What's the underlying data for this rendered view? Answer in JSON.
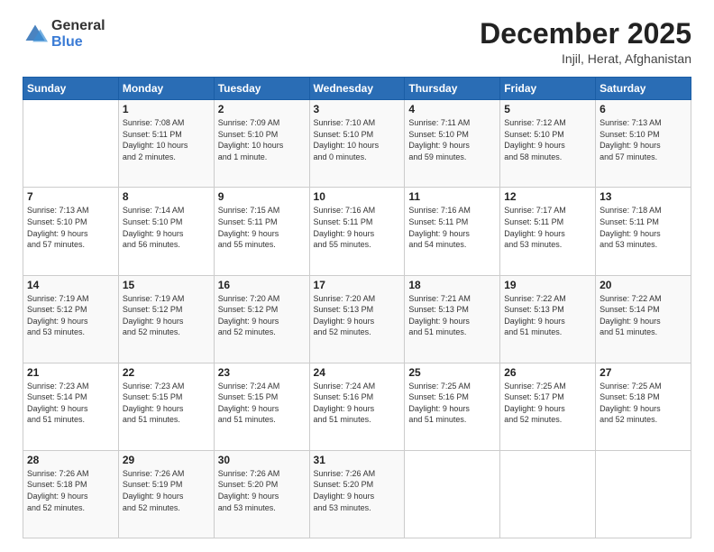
{
  "logo": {
    "general": "General",
    "blue": "Blue"
  },
  "header": {
    "month": "December 2025",
    "location": "Injil, Herat, Afghanistan"
  },
  "weekdays": [
    "Sunday",
    "Monday",
    "Tuesday",
    "Wednesday",
    "Thursday",
    "Friday",
    "Saturday"
  ],
  "weeks": [
    [
      {
        "day": "",
        "info": ""
      },
      {
        "day": "1",
        "info": "Sunrise: 7:08 AM\nSunset: 5:11 PM\nDaylight: 10 hours\nand 2 minutes."
      },
      {
        "day": "2",
        "info": "Sunrise: 7:09 AM\nSunset: 5:10 PM\nDaylight: 10 hours\nand 1 minute."
      },
      {
        "day": "3",
        "info": "Sunrise: 7:10 AM\nSunset: 5:10 PM\nDaylight: 10 hours\nand 0 minutes."
      },
      {
        "day": "4",
        "info": "Sunrise: 7:11 AM\nSunset: 5:10 PM\nDaylight: 9 hours\nand 59 minutes."
      },
      {
        "day": "5",
        "info": "Sunrise: 7:12 AM\nSunset: 5:10 PM\nDaylight: 9 hours\nand 58 minutes."
      },
      {
        "day": "6",
        "info": "Sunrise: 7:13 AM\nSunset: 5:10 PM\nDaylight: 9 hours\nand 57 minutes."
      }
    ],
    [
      {
        "day": "7",
        "info": "Sunrise: 7:13 AM\nSunset: 5:10 PM\nDaylight: 9 hours\nand 57 minutes."
      },
      {
        "day": "8",
        "info": "Sunrise: 7:14 AM\nSunset: 5:10 PM\nDaylight: 9 hours\nand 56 minutes."
      },
      {
        "day": "9",
        "info": "Sunrise: 7:15 AM\nSunset: 5:11 PM\nDaylight: 9 hours\nand 55 minutes."
      },
      {
        "day": "10",
        "info": "Sunrise: 7:16 AM\nSunset: 5:11 PM\nDaylight: 9 hours\nand 55 minutes."
      },
      {
        "day": "11",
        "info": "Sunrise: 7:16 AM\nSunset: 5:11 PM\nDaylight: 9 hours\nand 54 minutes."
      },
      {
        "day": "12",
        "info": "Sunrise: 7:17 AM\nSunset: 5:11 PM\nDaylight: 9 hours\nand 53 minutes."
      },
      {
        "day": "13",
        "info": "Sunrise: 7:18 AM\nSunset: 5:11 PM\nDaylight: 9 hours\nand 53 minutes."
      }
    ],
    [
      {
        "day": "14",
        "info": "Sunrise: 7:19 AM\nSunset: 5:12 PM\nDaylight: 9 hours\nand 53 minutes."
      },
      {
        "day": "15",
        "info": "Sunrise: 7:19 AM\nSunset: 5:12 PM\nDaylight: 9 hours\nand 52 minutes."
      },
      {
        "day": "16",
        "info": "Sunrise: 7:20 AM\nSunset: 5:12 PM\nDaylight: 9 hours\nand 52 minutes."
      },
      {
        "day": "17",
        "info": "Sunrise: 7:20 AM\nSunset: 5:13 PM\nDaylight: 9 hours\nand 52 minutes."
      },
      {
        "day": "18",
        "info": "Sunrise: 7:21 AM\nSunset: 5:13 PM\nDaylight: 9 hours\nand 51 minutes."
      },
      {
        "day": "19",
        "info": "Sunrise: 7:22 AM\nSunset: 5:13 PM\nDaylight: 9 hours\nand 51 minutes."
      },
      {
        "day": "20",
        "info": "Sunrise: 7:22 AM\nSunset: 5:14 PM\nDaylight: 9 hours\nand 51 minutes."
      }
    ],
    [
      {
        "day": "21",
        "info": "Sunrise: 7:23 AM\nSunset: 5:14 PM\nDaylight: 9 hours\nand 51 minutes."
      },
      {
        "day": "22",
        "info": "Sunrise: 7:23 AM\nSunset: 5:15 PM\nDaylight: 9 hours\nand 51 minutes."
      },
      {
        "day": "23",
        "info": "Sunrise: 7:24 AM\nSunset: 5:15 PM\nDaylight: 9 hours\nand 51 minutes."
      },
      {
        "day": "24",
        "info": "Sunrise: 7:24 AM\nSunset: 5:16 PM\nDaylight: 9 hours\nand 51 minutes."
      },
      {
        "day": "25",
        "info": "Sunrise: 7:25 AM\nSunset: 5:16 PM\nDaylight: 9 hours\nand 51 minutes."
      },
      {
        "day": "26",
        "info": "Sunrise: 7:25 AM\nSunset: 5:17 PM\nDaylight: 9 hours\nand 52 minutes."
      },
      {
        "day": "27",
        "info": "Sunrise: 7:25 AM\nSunset: 5:18 PM\nDaylight: 9 hours\nand 52 minutes."
      }
    ],
    [
      {
        "day": "28",
        "info": "Sunrise: 7:26 AM\nSunset: 5:18 PM\nDaylight: 9 hours\nand 52 minutes."
      },
      {
        "day": "29",
        "info": "Sunrise: 7:26 AM\nSunset: 5:19 PM\nDaylight: 9 hours\nand 52 minutes."
      },
      {
        "day": "30",
        "info": "Sunrise: 7:26 AM\nSunset: 5:20 PM\nDaylight: 9 hours\nand 53 minutes."
      },
      {
        "day": "31",
        "info": "Sunrise: 7:26 AM\nSunset: 5:20 PM\nDaylight: 9 hours\nand 53 minutes."
      },
      {
        "day": "",
        "info": ""
      },
      {
        "day": "",
        "info": ""
      },
      {
        "day": "",
        "info": ""
      }
    ]
  ]
}
